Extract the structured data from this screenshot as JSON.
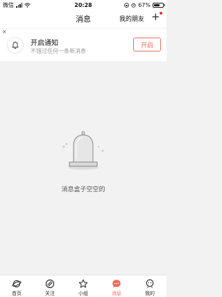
{
  "status_bar": {
    "carrier": "微信",
    "time": "20:28",
    "battery": "67%",
    "battery_level": 0.67
  },
  "navbar": {
    "title": "消息",
    "friends_label": "我的朋友",
    "add_symbol": "+"
  },
  "notification": {
    "close_symbol": "×",
    "title": "开启通知",
    "subtitle": "不错过任何一条新消息",
    "button_label": "开启"
  },
  "empty_state": {
    "text": "消息盒子空空的"
  },
  "tabbar": {
    "active_color": "#f06a5e",
    "items": [
      {
        "label": "首页",
        "icon": "planet-icon"
      },
      {
        "label": "关注",
        "icon": "follow-icon"
      },
      {
        "label": "小组",
        "icon": "star-icon"
      },
      {
        "label": "消息",
        "icon": "message-icon",
        "active": true
      },
      {
        "label": "我的",
        "icon": "profile-icon"
      }
    ]
  }
}
